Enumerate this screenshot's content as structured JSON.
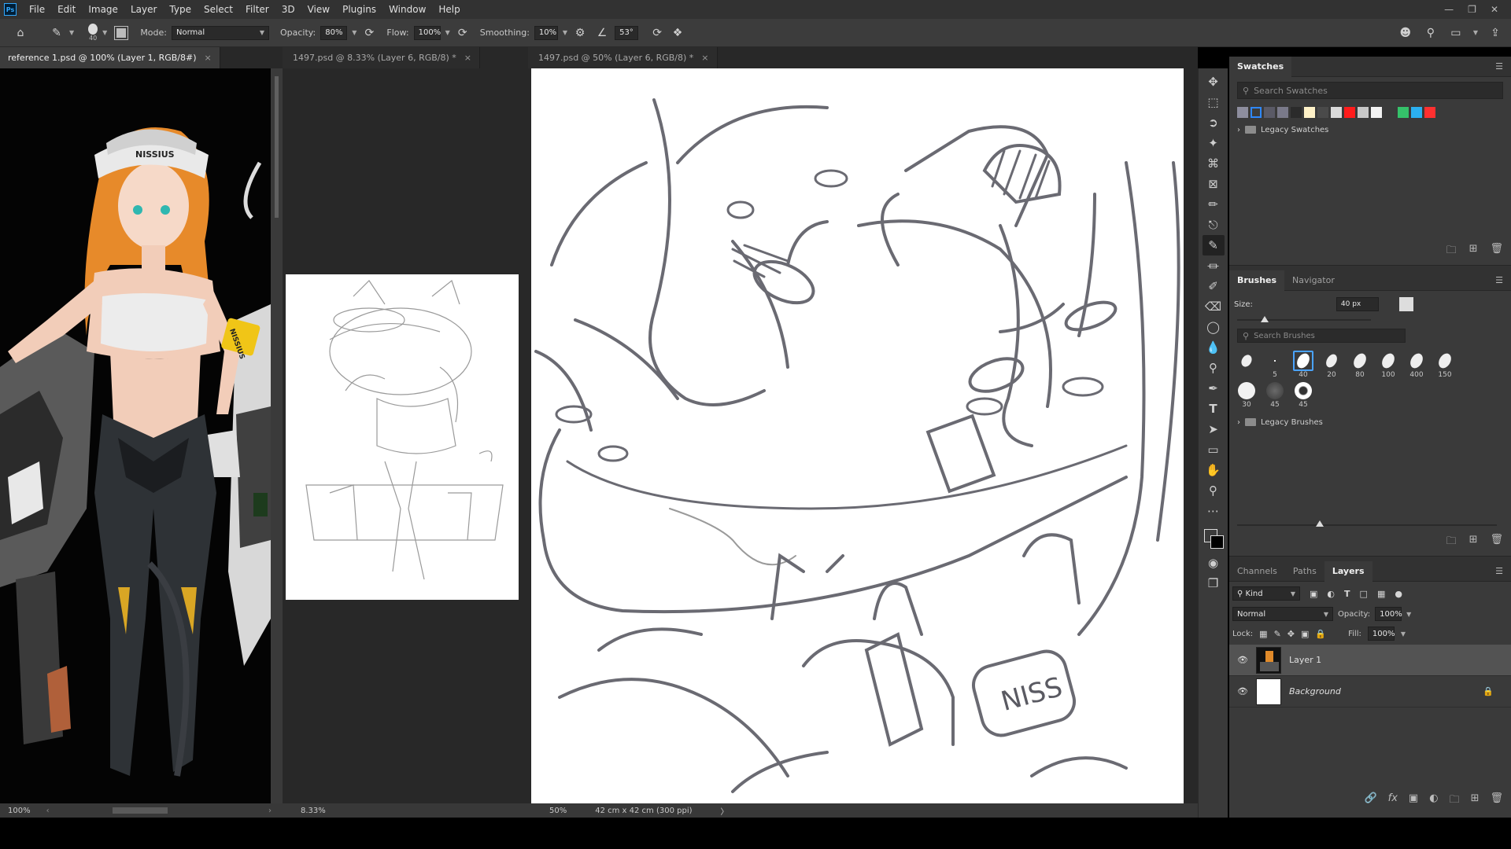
{
  "app": {
    "logo": "Ps"
  },
  "menu": [
    "File",
    "Edit",
    "Image",
    "Layer",
    "Type",
    "Select",
    "Filter",
    "3D",
    "View",
    "Plugins",
    "Window",
    "Help"
  ],
  "options": {
    "brush_size": "40",
    "mode_label": "Mode:",
    "mode_value": "Normal",
    "opacity_label": "Opacity:",
    "opacity_value": "80%",
    "flow_label": "Flow:",
    "flow_value": "100%",
    "smoothing_label": "Smoothing:",
    "smoothing_value": "10%",
    "angle_value": "53°"
  },
  "tabs": [
    {
      "label": "reference 1.psd @ 100% (Layer 1, RGB/8#)",
      "close": "×"
    },
    {
      "label": "1497.psd @ 8.33% (Layer 6, RGB/8) *",
      "close": "×"
    },
    {
      "label": "1497.psd @ 50% (Layer 6, RGB/8) *",
      "close": "×"
    }
  ],
  "status": {
    "left_zoom": "100%",
    "mid_zoom": "8.33%",
    "right_zoom": "50%",
    "doc_size": "42 cm x 42 cm (300 ppi)",
    "arrow": "〉"
  },
  "reference": {
    "cap_text": "NISSIUS",
    "armband_text": "NISSIUS"
  },
  "swatches": {
    "title": "Swatches",
    "search_placeholder": "Search Swatches",
    "colors": [
      "#8e8e9e",
      "#2f88ff",
      "#5a5a66",
      "#7a7a8a",
      "#2b2b2b",
      "#fff2c8",
      "#4a4a4a",
      "#dadada",
      "#ff1c1c",
      "#c8c8c8",
      "#f2f2f2",
      "#3a3a3a",
      "#35c26a",
      "#2bb0f0",
      "#ff3030"
    ],
    "group": "Legacy Swatches"
  },
  "brushes": {
    "tab_brushes": "Brushes",
    "tab_navigator": "Navigator",
    "size_label": "Size:",
    "size_value": "40 px",
    "search_placeholder": "Search Brushes",
    "presets_row1": [
      "",
      "5",
      "40",
      "20",
      "80",
      "100",
      "400",
      "150"
    ],
    "presets_row2": [
      "30",
      "45",
      "45"
    ],
    "group": "Legacy Brushes"
  },
  "layers": {
    "tab_channels": "Channels",
    "tab_paths": "Paths",
    "tab_layers": "Layers",
    "kind": "Kind",
    "blend": "Normal",
    "opacity_label": "Opacity:",
    "opacity_value": "100%",
    "lock_label": "Lock:",
    "fill_label": "Fill:",
    "fill_value": "100%",
    "items": [
      {
        "name": "Layer 1"
      },
      {
        "name": "Background"
      }
    ]
  },
  "sketch": {
    "armband_text": "NISS"
  }
}
